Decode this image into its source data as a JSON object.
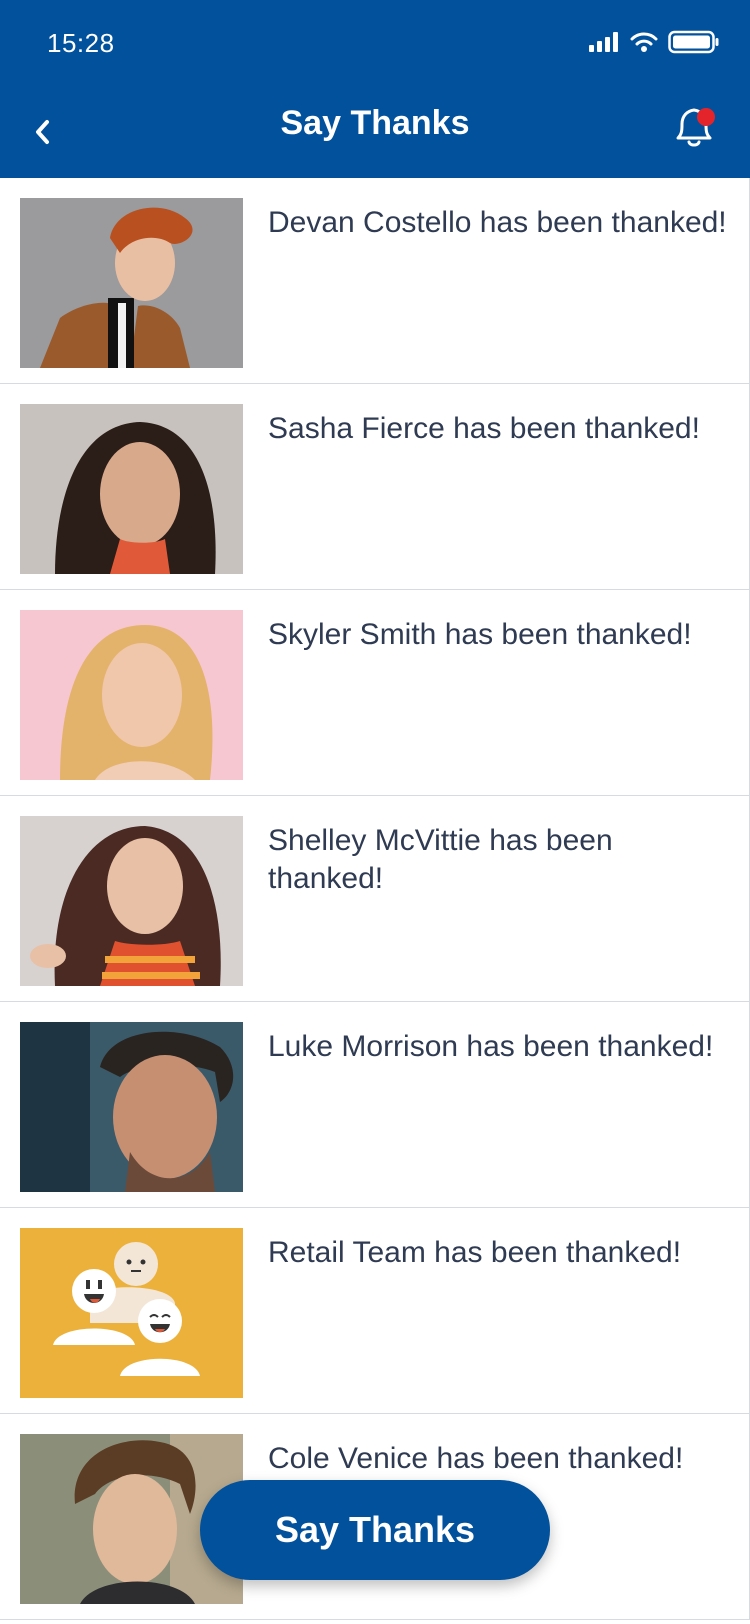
{
  "status_bar": {
    "time": "15:28"
  },
  "header": {
    "title": "Say Thanks",
    "back_icon": "chevron-left-icon",
    "notification_icon": "bell-icon",
    "notification_dot_color": "#e3242b"
  },
  "colors": {
    "brand": "#02519c",
    "text": "#2f3b52"
  },
  "feed": {
    "items": [
      {
        "text": "Devan Costello has been thanked!",
        "photo": "man-red-hair-brown-jacket",
        "bg": "#9b9a9c"
      },
      {
        "text": "Sasha Fierce has been thanked!",
        "photo": "woman-dark-hair",
        "bg": "#c7c2bd"
      },
      {
        "text": "Skyler Smith has been thanked!",
        "photo": "woman-blonde-pink-background",
        "bg": "#f6c7d0"
      },
      {
        "text": "Shelley McVittie has been thanked!",
        "photo": "woman-brown-hair-striped-top",
        "bg": "#d7d2d0"
      },
      {
        "text": "Luke Morrison has been thanked!",
        "photo": "man-dark-hair",
        "bg": "#3a5a6a"
      },
      {
        "text": "Retail Team has been thanked!",
        "photo": "team-illustration",
        "bg": "#ecb13a"
      },
      {
        "text": "Cole Venice has been thanked!",
        "photo": "man-wavy-hair",
        "bg": "#8b8f7a"
      }
    ]
  },
  "fab": {
    "label": "Say Thanks"
  }
}
